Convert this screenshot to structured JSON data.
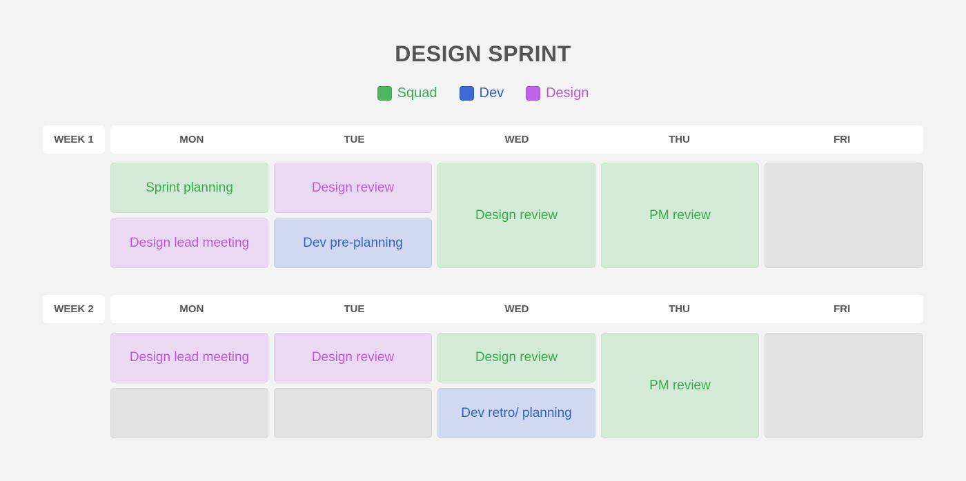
{
  "title": "DESIGN SPRINT",
  "legend": [
    {
      "label": "Squad",
      "color": "#4cb85f"
    },
    {
      "label": "Dev",
      "color": "#3d6ad6"
    },
    {
      "label": "Design",
      "color": "#c063e8"
    }
  ],
  "colors": {
    "squad_bg": "#d3ead6",
    "squad_text": "#3aaa4e",
    "dev_bg": "#d0d9ef",
    "dev_text": "#3562c4",
    "design_bg": "#ebd8f3",
    "design_text": "#b75ad7",
    "empty_bg": "#e2e2e2"
  },
  "weeks": [
    {
      "label": "WEEK 1",
      "days": [
        "MON",
        "TUE",
        "WED",
        "THU",
        "FRI"
      ],
      "events": [
        {
          "label": "Sprint planning",
          "category": "squad"
        },
        {
          "label": "Design lead meeting",
          "category": "design"
        },
        {
          "label": "Design review",
          "category": "design"
        },
        {
          "label": "Dev pre-planning",
          "category": "dev"
        },
        {
          "label": "Design review",
          "category": "squad"
        },
        {
          "label": "PM review",
          "category": "squad"
        },
        {
          "label": "",
          "category": "empty"
        }
      ]
    },
    {
      "label": "WEEK 2",
      "days": [
        "MON",
        "TUE",
        "WED",
        "THU",
        "FRI"
      ],
      "events": [
        {
          "label": "Design lead meeting",
          "category": "design"
        },
        {
          "label": "",
          "category": "empty"
        },
        {
          "label": "Design review",
          "category": "design"
        },
        {
          "label": "",
          "category": "empty"
        },
        {
          "label": "Design review",
          "category": "squad"
        },
        {
          "label": "Dev retro/ planning",
          "category": "dev"
        },
        {
          "label": "PM review",
          "category": "squad"
        },
        {
          "label": "",
          "category": "empty"
        }
      ]
    }
  ]
}
